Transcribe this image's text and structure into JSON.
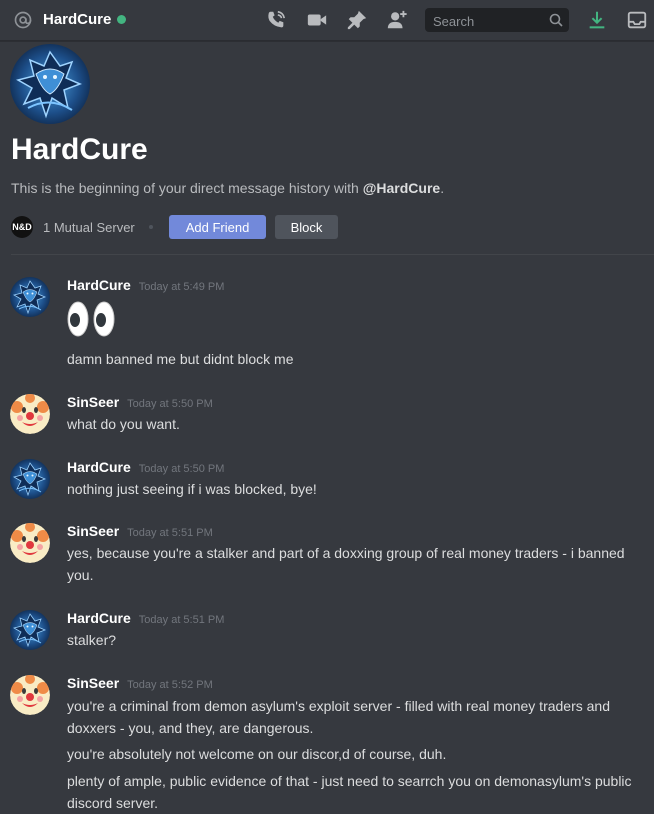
{
  "header": {
    "name": "HardCure",
    "status_color": "#43b581",
    "icons": [
      "at-icon",
      "phone-call-icon",
      "video-camera-icon",
      "pin-icon",
      "add-friend-icon",
      "search-icon",
      "download-icon",
      "inbox-icon"
    ],
    "search_placeholder": "Search"
  },
  "intro": {
    "title": "HardCure",
    "description_prefix": "This is the beginning of your direct message history with ",
    "description_handle": "@HardCure",
    "description_suffix": ".",
    "mutual_server_icon": "N&D",
    "mutual_servers": "1 Mutual Server",
    "add_friend_label": "Add Friend",
    "block_label": "Block"
  },
  "messages": [
    {
      "author": "HardCure",
      "time": "Today at 5:49 PM",
      "lines": [
        "damn banned me but didnt block me"
      ],
      "emoji": "eyes"
    },
    {
      "author": "SinSeer",
      "time": "Today at 5:50 PM",
      "lines": [
        "what do you want."
      ]
    },
    {
      "author": "HardCure",
      "time": "Today at 5:50 PM",
      "lines": [
        "nothing just seeing if i was blocked, bye!"
      ]
    },
    {
      "author": "SinSeer",
      "time": "Today at 5:51 PM",
      "lines": [
        "yes, because you're a stalker and part of a doxxing group of real money traders - i banned you."
      ]
    },
    {
      "author": "HardCure",
      "time": "Today at 5:51 PM",
      "lines": [
        "stalker?"
      ]
    },
    {
      "author": "SinSeer",
      "time": "Today at 5:52 PM",
      "lines": [
        "you're a criminal from demon asylum's exploit server - filled with real money traders and doxxers - you, and they, are dangerous.",
        "you're absolutely not welcome on our discor,d of course, duh.",
        "plenty of ample, public evidence of that - just need to searrch you on demonasylum's public discord server."
      ]
    }
  ]
}
